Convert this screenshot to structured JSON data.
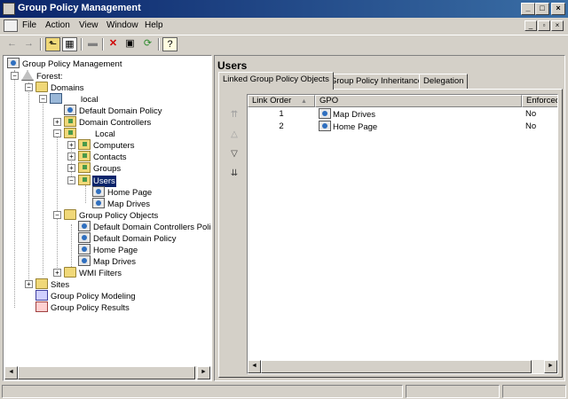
{
  "window": {
    "title": "Group Policy Management",
    "minimize": "_",
    "maximize": "□",
    "close": "×"
  },
  "menu": {
    "items": [
      {
        "label": "File"
      },
      {
        "label": "Action"
      },
      {
        "label": "View"
      },
      {
        "label": "Window"
      },
      {
        "label": "Help"
      }
    ],
    "mdi": {
      "minimize": "_",
      "restore": "▫",
      "close": "×"
    }
  },
  "toolbar": {
    "back": "←",
    "forward": "→",
    "up": "⬑",
    "show_hide_tree": "▦",
    "print": "▬",
    "delete": "✕",
    "properties": "▣",
    "refresh": "⟳",
    "help": "?"
  },
  "tree": {
    "root": "Group Policy Management",
    "forest": "Forest:",
    "domains": "Domains",
    "domain_local": "local",
    "default_domain_policy": "Default Domain Policy",
    "domain_controllers": "Domain Controllers",
    "ou_local": "Local",
    "computers": "Computers",
    "contacts": "Contacts",
    "groups": "Groups",
    "users": "Users",
    "users_home_page": "Home Page",
    "users_map_drives": "Map Drives",
    "gpo_container": "Group Policy Objects",
    "gpo_default_dc": "Default Domain Controllers Policy",
    "gpo_default_domain": "Default Domain Policy",
    "gpo_home_page": "Home Page",
    "gpo_map_drives": "Map Drives",
    "wmi_filters": "WMI Filters",
    "sites": "Sites",
    "modeling": "Group Policy Modeling",
    "results": "Group Policy Results",
    "expanded_symbol": "−",
    "collapsed_symbol": "+"
  },
  "details": {
    "title": "Users",
    "tabs": [
      {
        "label": "Linked Group Policy Objects",
        "active": true
      },
      {
        "label": "Group Policy Inheritance",
        "active": false
      },
      {
        "label": "Delegation",
        "active": false
      }
    ],
    "order_buttons": {
      "top": "⇈",
      "up": "△",
      "down": "▽",
      "bottom": "⇊"
    },
    "columns": {
      "link_order": "Link Order",
      "gpo": "GPO",
      "enforced": "Enforced",
      "sort_indicator": "▲"
    },
    "rows": [
      {
        "link_order": "1",
        "gpo": "Map Drives",
        "enforced": "No"
      },
      {
        "link_order": "2",
        "gpo": "Home Page",
        "enforced": "No"
      }
    ]
  },
  "scroll": {
    "left": "◄",
    "right": "►"
  }
}
